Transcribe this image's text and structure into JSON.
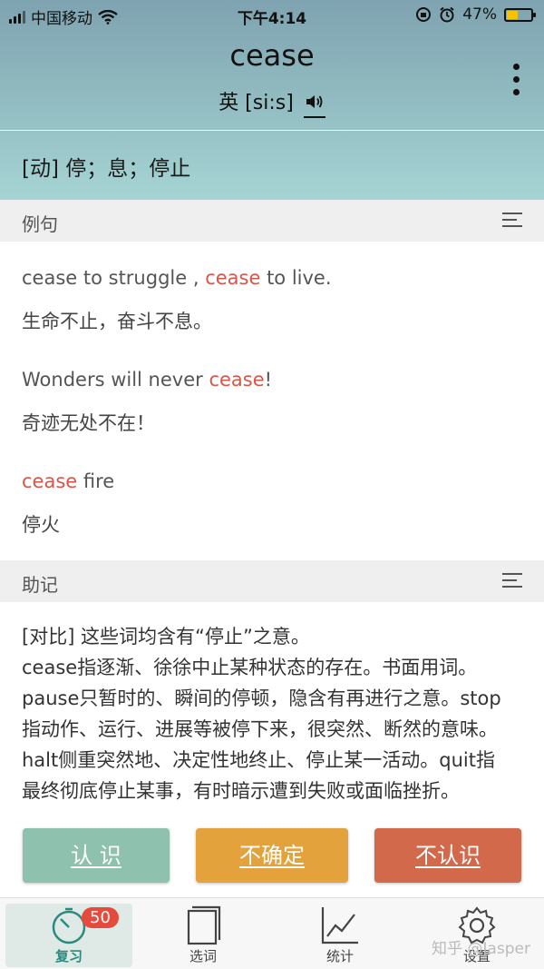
{
  "status_bar": {
    "carrier": "中国移动",
    "time": "下午4:14",
    "battery_percent": "47%",
    "battery_level": 0.47,
    "battery_color": "#f5c400"
  },
  "word": {
    "term": "cease",
    "phonetic_label": "英 [si:s]",
    "meaning": "[动] 停；息；停止"
  },
  "examples_section": {
    "title": "例句",
    "items": [
      {
        "en_parts": [
          "cease to struggle , ",
          "cease",
          " to live."
        ],
        "zh": "生命不止，奋斗不息。"
      },
      {
        "en_parts": [
          "Wonders will never ",
          "cease",
          "!"
        ],
        "zh": "奇迹无处不在！"
      },
      {
        "en_parts": [
          "",
          "cease",
          " fire"
        ],
        "zh": "停火"
      }
    ],
    "highlight_color": "#d6574a"
  },
  "mnemonic_section": {
    "title": "助记",
    "text_line1": "[对比] 这些词均含有“停止”之意。",
    "text_body": "cease指逐渐、徐徐中止某种状态的存在。书面用词。pause只暂时的、瞬间的停顿，隐含有再进行之意。stop指动作、运行、进展等被停下来，很突然、断然的意味。halt侧重突然地、决定性地终止、停止某一活动。quit指最终彻底停止某事，有时暗示遭到失败或面临挫折。"
  },
  "actions": {
    "know": "认 识",
    "unsure": "不确定",
    "unknown": "不认识"
  },
  "tabbar": {
    "review": "复习",
    "review_badge": "50",
    "select": "选词",
    "stats": "统计",
    "settings": "设置"
  },
  "watermark": "知乎 @Jasper"
}
